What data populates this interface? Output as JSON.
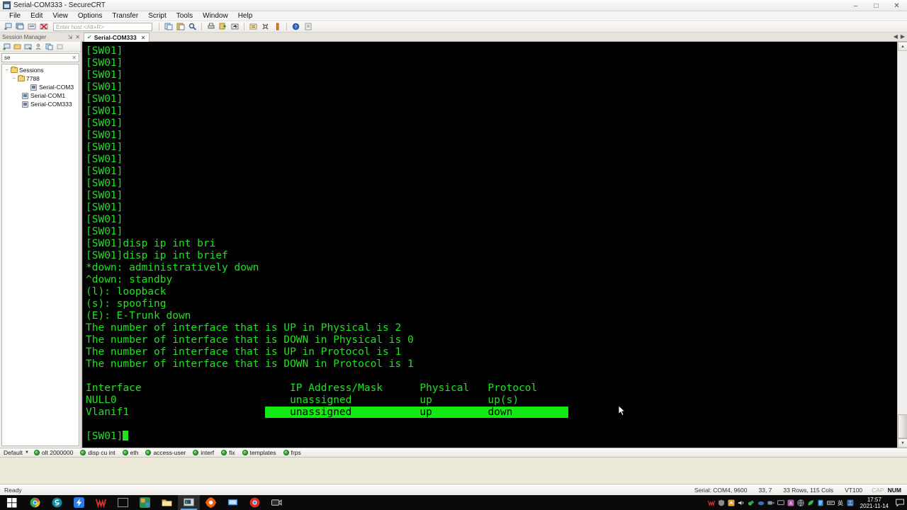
{
  "window": {
    "title": "Serial-COM333 - SecureCRT",
    "icon": "app-icon",
    "minimize": "–",
    "maximize": "□",
    "close": "✕"
  },
  "menu": {
    "items": [
      "File",
      "Edit",
      "View",
      "Options",
      "Transfer",
      "Script",
      "Tools",
      "Window",
      "Help"
    ]
  },
  "toolbar": {
    "host_placeholder": "Enter host <Alt+R>",
    "buttons": [
      "new-session-icon",
      "clone-session-icon",
      "connect-sftp-icon",
      "disconnect-icon",
      "copy-icon",
      "paste-icon",
      "find-icon",
      "print-icon",
      "log-session-icon",
      "transfer-icon",
      "properties-icon",
      "options-icon",
      "keymap-icon",
      "help-icon",
      "about-icon"
    ]
  },
  "tab": {
    "label": "Serial-COM333",
    "check": "✔",
    "close": "✕",
    "nav_left": "◀",
    "nav_right": "▶"
  },
  "session_manager": {
    "title": "Session Manager",
    "pin": "⇲",
    "close": "✕",
    "filter_value": "se",
    "filter_clear": "✕",
    "toolbar_icons": [
      "new-session-icon",
      "new-folder-icon",
      "connect-icon",
      "properties-icon",
      "copy-icon",
      "delete-icon"
    ],
    "tree": [
      {
        "label": "Sessions",
        "type": "folder",
        "depth": 0,
        "expander": "−"
      },
      {
        "label": "7788",
        "type": "folder",
        "depth": 1,
        "expander": "−"
      },
      {
        "label": "Serial-COM3",
        "type": "session",
        "depth": 2,
        "expander": ""
      },
      {
        "label": "Serial-COM1",
        "type": "session",
        "depth": 1,
        "expander": ""
      },
      {
        "label": "Serial-COM333",
        "type": "session",
        "depth": 1,
        "expander": ""
      }
    ]
  },
  "terminal": {
    "fg_color": "#22e022",
    "bg_color": "#000000",
    "highlight_color": "#14e914",
    "lines": [
      {
        "text": "[SW01]"
      },
      {
        "text": "[SW01]"
      },
      {
        "text": "[SW01]"
      },
      {
        "text": "[SW01]"
      },
      {
        "text": "[SW01]"
      },
      {
        "text": "[SW01]"
      },
      {
        "text": "[SW01]"
      },
      {
        "text": "[SW01]"
      },
      {
        "text": "[SW01]"
      },
      {
        "text": "[SW01]"
      },
      {
        "text": "[SW01]"
      },
      {
        "text": "[SW01]"
      },
      {
        "text": "[SW01]"
      },
      {
        "text": "[SW01]"
      },
      {
        "text": "[SW01]"
      },
      {
        "text": "[SW01]"
      },
      {
        "text": "[SW01]disp ip int bri"
      },
      {
        "text": "[SW01]disp ip int brief"
      },
      {
        "text": "*down: administratively down"
      },
      {
        "text": "^down: standby"
      },
      {
        "text": "(l): loopback"
      },
      {
        "text": "(s): spoofing"
      },
      {
        "text": "(E): E-Trunk down"
      },
      {
        "text": "The number of interface that is UP in Physical is 2"
      },
      {
        "text": "The number of interface that is DOWN in Physical is 0"
      },
      {
        "text": "The number of interface that is UP in Protocol is 1"
      },
      {
        "text": "The number of interface that is DOWN in Protocol is 1"
      },
      {
        "text": ""
      },
      {
        "text": "Interface                        IP Address/Mask      Physical   Protocol"
      },
      {
        "text": "NULL0                            unassigned           up         up(s)"
      },
      {
        "pre": "Vlanif1                      ",
        "highlight": "    unassigned           up         down         ",
        "post": ""
      },
      {
        "text": ""
      },
      {
        "text": "[SW01]",
        "cursor": true
      }
    ]
  },
  "button_bar": {
    "session_label": "Default",
    "caret": "▼",
    "buttons": [
      "olt 2000000",
      "disp cu int",
      "eth",
      "access-user",
      "interf",
      "fix",
      "templates",
      "frps"
    ]
  },
  "status_bar": {
    "ready": "Ready",
    "serial": "Serial: COM4, 9600",
    "position": "33,  7",
    "size": "33 Rows, 115 Cols",
    "emulation": "VT100",
    "cap": "CAP",
    "num": "NUM"
  },
  "taskbar": {
    "start": "start-icon",
    "items": [
      {
        "name": "chrome-icon",
        "color": "#35a853"
      },
      {
        "name": "browser-s-icon",
        "color": "#1f9fb0"
      },
      {
        "name": "thunder-download-icon",
        "color": "#2a7de1"
      },
      {
        "name": "wps-office-icon",
        "color": "#d9302c"
      },
      {
        "name": "terminal-window-icon",
        "color": "#1a1a1a"
      },
      {
        "name": "media-player-icon",
        "color": "#e8a33d"
      },
      {
        "name": "file-explorer-icon",
        "color": "#f2c14e"
      },
      {
        "name": "securecrt-icon",
        "color": "#8aa0b8",
        "active": true
      },
      {
        "name": "settings-gear-icon",
        "color": "#e8610f"
      },
      {
        "name": "remote-desktop-icon",
        "color": "#3a8fd6"
      },
      {
        "name": "chrome-beta-icon",
        "color": "#d93025"
      },
      {
        "name": "screen-recorder-icon",
        "color": "#2b2b2b"
      }
    ],
    "tray": [
      {
        "name": "wps-tray-icon",
        "color": "#d9302c"
      },
      {
        "name": "shield-tray-icon",
        "color": "#9a9a9a"
      },
      {
        "name": "update-tray-icon",
        "color": "#e8a33d"
      },
      {
        "name": "volume-icon",
        "color": "#d8d8d8"
      },
      {
        "name": "network-tray-icon",
        "color": "#39b54a"
      },
      {
        "name": "cloud-tray-icon",
        "color": "#3b6fb5"
      },
      {
        "name": "camera-tray-icon",
        "color": "#7f8fa0"
      },
      {
        "name": "display-tray-icon",
        "color": "#8a8a8a"
      },
      {
        "name": "app-tray-icon",
        "color": "#b05ab0"
      },
      {
        "name": "globe-tray-icon",
        "color": "#9aa5b1"
      },
      {
        "name": "leaf-tray-icon",
        "color": "#39b54a"
      },
      {
        "name": "doc-tray-icon",
        "color": "#3b8fd6"
      },
      {
        "name": "keyboard-tray-icon",
        "color": "#e8e8e8"
      },
      {
        "name": "ime-tray-icon",
        "color": "#e8e8e8"
      },
      {
        "name": "blue-app-tray-icon",
        "color": "#3b6fb5"
      }
    ],
    "clock_time": "17:57",
    "clock_date": "2021-11-14",
    "notification": "notification-icon"
  }
}
